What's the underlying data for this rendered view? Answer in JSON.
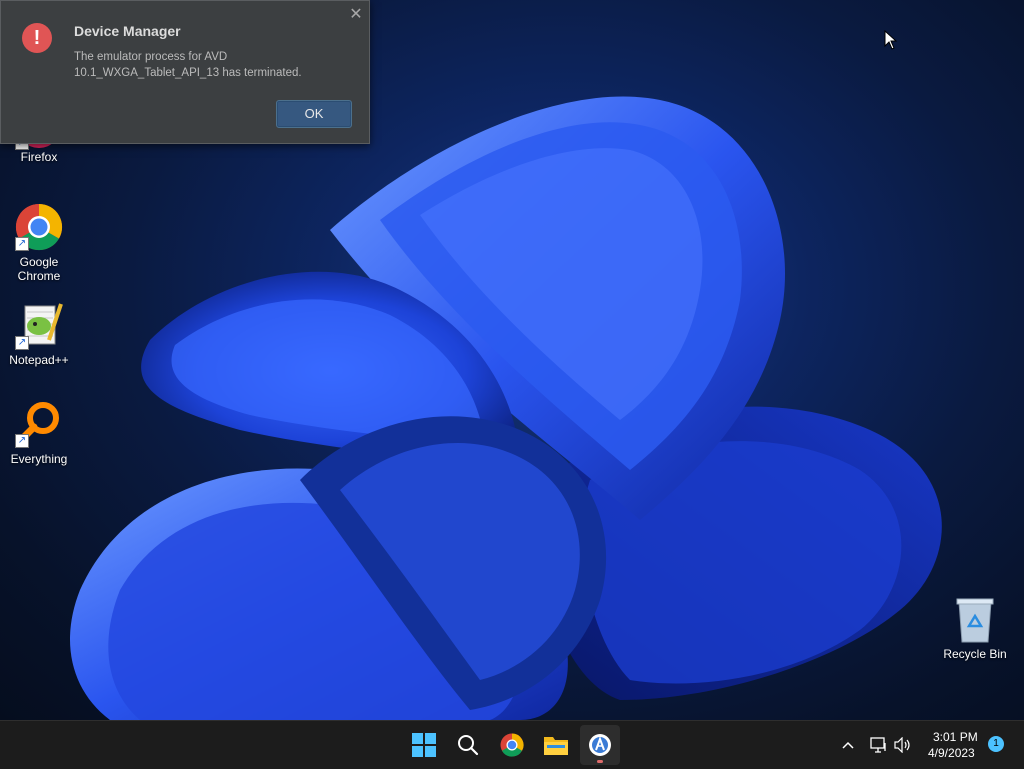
{
  "dialog": {
    "title": "Device Manager",
    "message_line1": "The emulator process for AVD",
    "message_line2": "10.1_WXGA_Tablet_API_13 has terminated.",
    "ok_label": "OK",
    "close_glyph": "✕",
    "icon": "error-icon"
  },
  "desktop_icons": [
    {
      "label": "Firefox",
      "icon": "firefox-icon"
    },
    {
      "label": "Google Chrome",
      "label_line1": "Google",
      "label_line2": "Chrome",
      "icon": "chrome-icon"
    },
    {
      "label": "Notepad++",
      "icon": "notepadpp-icon"
    },
    {
      "label": "Everything",
      "icon": "everything-search-icon"
    },
    {
      "label": "Recycle Bin",
      "icon": "recycle-bin-icon"
    }
  ],
  "taskbar": {
    "apps": [
      "windows-start-icon",
      "search-icon",
      "chrome-icon",
      "file-explorer-icon",
      "android-studio-icon"
    ],
    "time": "3:01 PM",
    "date": "4/9/2023",
    "notification_count": "1",
    "tray_icons": [
      "chevron-up-icon",
      "network-icon",
      "volume-icon"
    ]
  },
  "colors": {
    "dialog_bg": "#3c3f41",
    "ok_button": "#365880",
    "error_red": "#e05555",
    "taskbar_bg": "#1c1c1c",
    "wallpaper_blue": "#1f4fe0"
  }
}
